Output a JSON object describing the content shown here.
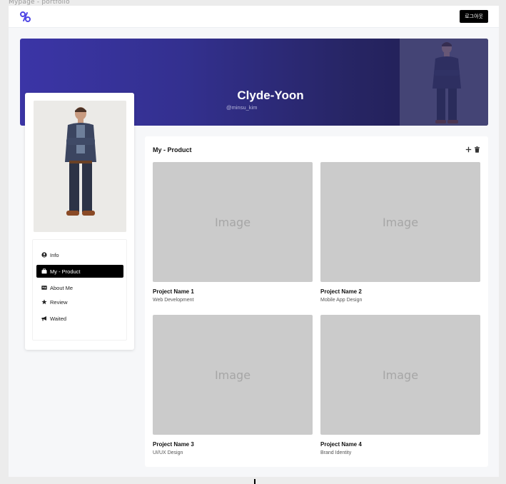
{
  "frame_label": "Mypage - portfolio",
  "header": {
    "logout_label": "로그아웃",
    "brand_color": "#4f46e5"
  },
  "banner": {
    "name": "Clyde-Yoon",
    "handle": "@minsu_kim"
  },
  "sidebar": {
    "items": [
      {
        "label": "Info",
        "icon": "user-circle-icon"
      },
      {
        "label": "My - Product",
        "icon": "briefcase-icon",
        "active": true
      },
      {
        "label": "About Me",
        "icon": "id-card-icon"
      },
      {
        "label": "Review",
        "icon": "star-icon"
      },
      {
        "label": "Waited",
        "icon": "megaphone-icon"
      }
    ]
  },
  "main": {
    "title": "My - Product",
    "actions": [
      "plus-icon",
      "trash-icon"
    ],
    "projects": [
      {
        "image_label": "Image",
        "name": "Project Name 1",
        "category": "Web Development"
      },
      {
        "image_label": "Image",
        "name": "Project Name 2",
        "category": "Mobile App Design"
      },
      {
        "image_label": "Image",
        "name": "Project Name 3",
        "category": "UI/UX Design"
      },
      {
        "image_label": "Image",
        "name": "Project Name 4",
        "category": "Brand Identity"
      }
    ]
  }
}
